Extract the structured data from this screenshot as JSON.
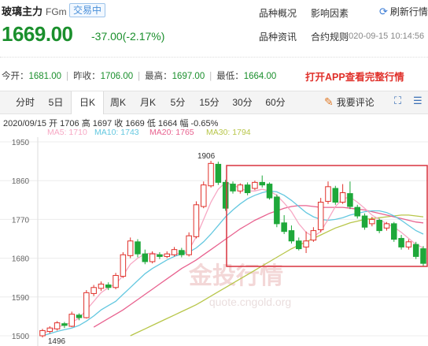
{
  "header": {
    "title": "玻璃主力",
    "code": "FGm",
    "badge": "交易中",
    "nav": [
      "品种概况",
      "影响因素",
      "品种资讯",
      "合约规则"
    ],
    "refresh_label": "刷新行情"
  },
  "quote": {
    "price": "1669.00",
    "change": "-37.00(-2.17%)",
    "timestamp": "2020-09-15 10:14:56"
  },
  "stats": {
    "open_label": "今开：",
    "open": "1681.00",
    "prev_label": "昨收：",
    "prev": "1706.00",
    "high_label": "最高：",
    "high": "1697.00",
    "low_label": "最低：",
    "low": "1664.00"
  },
  "app_banner": "打开APP查看完整行情",
  "tabs": [
    "分时",
    "5日",
    "日K",
    "周K",
    "月K",
    "5分",
    "15分",
    "30分",
    "60分"
  ],
  "active_tab": "日K",
  "comment_label": "我要评论",
  "tools": [
    "expand-icon",
    "list-icon"
  ],
  "chart_info": "2020/09/15  开 1706  高 1697  收 1669  低 1664  幅 -0.65%",
  "ma_labels": [
    {
      "text": "MA5: 1710",
      "color": "#f7a8c4"
    },
    {
      "text": "MA10: 1743",
      "color": "#64c8e0"
    },
    {
      "text": "MA20: 1765",
      "color": "#e8628f"
    },
    {
      "text": "MA30: 1794",
      "color": "#b8c64a"
    }
  ],
  "watermark": {
    "brand": "金投行情",
    "url": "quote.cngold.org"
  },
  "colors": {
    "up": "#e0302a",
    "down": "#1ea83a",
    "highlight_box": "#d9333f"
  },
  "chart_data": {
    "type": "candlestick",
    "y_ticks": [
      "1950",
      "1860",
      "1770",
      "1680",
      "1590",
      "1500"
    ],
    "ylim": [
      1500,
      1950
    ],
    "annotations": [
      {
        "text": "1906",
        "value": 1906
      },
      {
        "text": "1496",
        "value": 1496
      }
    ],
    "candles": [
      {
        "o": 1500,
        "c": 1512,
        "h": 1516,
        "l": 1496
      },
      {
        "o": 1510,
        "c": 1518,
        "h": 1522,
        "l": 1505
      },
      {
        "o": 1516,
        "c": 1530,
        "h": 1534,
        "l": 1512
      },
      {
        "o": 1528,
        "c": 1524,
        "h": 1532,
        "l": 1518
      },
      {
        "o": 1522,
        "c": 1550,
        "h": 1556,
        "l": 1520
      },
      {
        "o": 1548,
        "c": 1542,
        "h": 1552,
        "l": 1536
      },
      {
        "o": 1542,
        "c": 1600,
        "h": 1606,
        "l": 1540
      },
      {
        "o": 1598,
        "c": 1612,
        "h": 1618,
        "l": 1592
      },
      {
        "o": 1610,
        "c": 1620,
        "h": 1626,
        "l": 1604
      },
      {
        "o": 1618,
        "c": 1612,
        "h": 1624,
        "l": 1606
      },
      {
        "o": 1612,
        "c": 1640,
        "h": 1646,
        "l": 1608
      },
      {
        "o": 1638,
        "c": 1688,
        "h": 1694,
        "l": 1634
      },
      {
        "o": 1686,
        "c": 1720,
        "h": 1728,
        "l": 1680
      },
      {
        "o": 1718,
        "c": 1690,
        "h": 1724,
        "l": 1682
      },
      {
        "o": 1690,
        "c": 1672,
        "h": 1700,
        "l": 1666
      },
      {
        "o": 1672,
        "c": 1690,
        "h": 1696,
        "l": 1668
      },
      {
        "o": 1688,
        "c": 1684,
        "h": 1694,
        "l": 1678
      },
      {
        "o": 1684,
        "c": 1690,
        "h": 1696,
        "l": 1680
      },
      {
        "o": 1688,
        "c": 1700,
        "h": 1706,
        "l": 1684
      },
      {
        "o": 1698,
        "c": 1688,
        "h": 1704,
        "l": 1682
      },
      {
        "o": 1688,
        "c": 1732,
        "h": 1740,
        "l": 1684
      },
      {
        "o": 1730,
        "c": 1804,
        "h": 1812,
        "l": 1726
      },
      {
        "o": 1800,
        "c": 1850,
        "h": 1858,
        "l": 1796
      },
      {
        "o": 1848,
        "c": 1900,
        "h": 1906,
        "l": 1844
      },
      {
        "o": 1898,
        "c": 1856,
        "h": 1904,
        "l": 1850
      },
      {
        "o": 1856,
        "c": 1796,
        "h": 1862,
        "l": 1790
      },
      {
        "o": 1852,
        "c": 1836,
        "h": 1858,
        "l": 1830
      },
      {
        "o": 1836,
        "c": 1850,
        "h": 1854,
        "l": 1830
      },
      {
        "o": 1850,
        "c": 1832,
        "h": 1856,
        "l": 1826
      },
      {
        "o": 1842,
        "c": 1856,
        "h": 1860,
        "l": 1838
      },
      {
        "o": 1856,
        "c": 1850,
        "h": 1872,
        "l": 1844
      },
      {
        "o": 1852,
        "c": 1820,
        "h": 1856,
        "l": 1816
      },
      {
        "o": 1822,
        "c": 1760,
        "h": 1828,
        "l": 1752
      },
      {
        "o": 1762,
        "c": 1742,
        "h": 1780,
        "l": 1736
      },
      {
        "o": 1744,
        "c": 1720,
        "h": 1756,
        "l": 1714
      },
      {
        "o": 1720,
        "c": 1702,
        "h": 1728,
        "l": 1698
      },
      {
        "o": 1706,
        "c": 1720,
        "h": 1742,
        "l": 1692
      },
      {
        "o": 1722,
        "c": 1744,
        "h": 1752,
        "l": 1718
      },
      {
        "o": 1746,
        "c": 1810,
        "h": 1820,
        "l": 1740
      },
      {
        "o": 1812,
        "c": 1846,
        "h": 1858,
        "l": 1806
      },
      {
        "o": 1842,
        "c": 1810,
        "h": 1848,
        "l": 1804
      },
      {
        "o": 1810,
        "c": 1832,
        "h": 1852,
        "l": 1806
      },
      {
        "o": 1830,
        "c": 1800,
        "h": 1858,
        "l": 1794
      },
      {
        "o": 1798,
        "c": 1778,
        "h": 1804,
        "l": 1772
      },
      {
        "o": 1778,
        "c": 1752,
        "h": 1784,
        "l": 1746
      },
      {
        "o": 1760,
        "c": 1770,
        "h": 1776,
        "l": 1754
      },
      {
        "o": 1768,
        "c": 1744,
        "h": 1772,
        "l": 1738
      },
      {
        "o": 1750,
        "c": 1760,
        "h": 1764,
        "l": 1744
      },
      {
        "o": 1760,
        "c": 1724,
        "h": 1764,
        "l": 1718
      },
      {
        "o": 1726,
        "c": 1706,
        "h": 1734,
        "l": 1700
      },
      {
        "o": 1706,
        "c": 1718,
        "h": 1724,
        "l": 1700
      },
      {
        "o": 1712,
        "c": 1684,
        "h": 1718,
        "l": 1678
      },
      {
        "o": 1702,
        "c": 1668,
        "h": 1708,
        "l": 1662
      }
    ],
    "ma5": [
      1505,
      1512,
      1520,
      1525,
      1531,
      1541,
      1560,
      1580,
      1600,
      1612,
      1620,
      1640,
      1666,
      1680,
      1690,
      1692,
      1688,
      1686,
      1690,
      1692,
      1700,
      1730,
      1770,
      1810,
      1840,
      1856,
      1850,
      1842,
      1836,
      1836,
      1840,
      1836,
      1826,
      1808,
      1788,
      1760,
      1740,
      1730,
      1742,
      1770,
      1800,
      1818,
      1822,
      1810,
      1796,
      1780,
      1770,
      1760,
      1752,
      1740,
      1726,
      1712,
      1704
    ],
    "ma10": [
      1500,
      1505,
      1510,
      1514,
      1518,
      1524,
      1534,
      1546,
      1560,
      1570,
      1580,
      1596,
      1612,
      1628,
      1644,
      1656,
      1666,
      1676,
      1684,
      1690,
      1694,
      1704,
      1718,
      1736,
      1756,
      1776,
      1792,
      1806,
      1818,
      1826,
      1832,
      1836,
      1834,
      1826,
      1814,
      1800,
      1786,
      1776,
      1770,
      1768,
      1770,
      1774,
      1780,
      1784,
      1788,
      1790,
      1790,
      1786,
      1778,
      1768,
      1756,
      1744,
      1736
    ],
    "ma20": [
      null,
      null,
      null,
      null,
      null,
      null,
      null,
      1520,
      1530,
      1540,
      1550,
      1560,
      1572,
      1584,
      1596,
      1608,
      1620,
      1632,
      1644,
      1656,
      1666,
      1676,
      1688,
      1700,
      1712,
      1724,
      1736,
      1748,
      1758,
      1768,
      1776,
      1784,
      1790,
      1796,
      1800,
      1802,
      1802,
      1800,
      1798,
      1798,
      1798,
      1798,
      1796,
      1794,
      1792,
      1788,
      1784,
      1780,
      1776,
      1772,
      1768,
      1764,
      1762
    ],
    "ma30": [
      null,
      null,
      null,
      null,
      null,
      null,
      null,
      null,
      null,
      null,
      null,
      null,
      1500,
      1508,
      1516,
      1524,
      1532,
      1540,
      1548,
      1556,
      1564,
      1572,
      1582,
      1592,
      1602,
      1612,
      1622,
      1632,
      1642,
      1652,
      1662,
      1672,
      1682,
      1692,
      1702,
      1710,
      1718,
      1726,
      1734,
      1742,
      1750,
      1756,
      1762,
      1766,
      1770,
      1772,
      1774,
      1776,
      1778,
      1780,
      1780,
      1778,
      1776
    ]
  }
}
